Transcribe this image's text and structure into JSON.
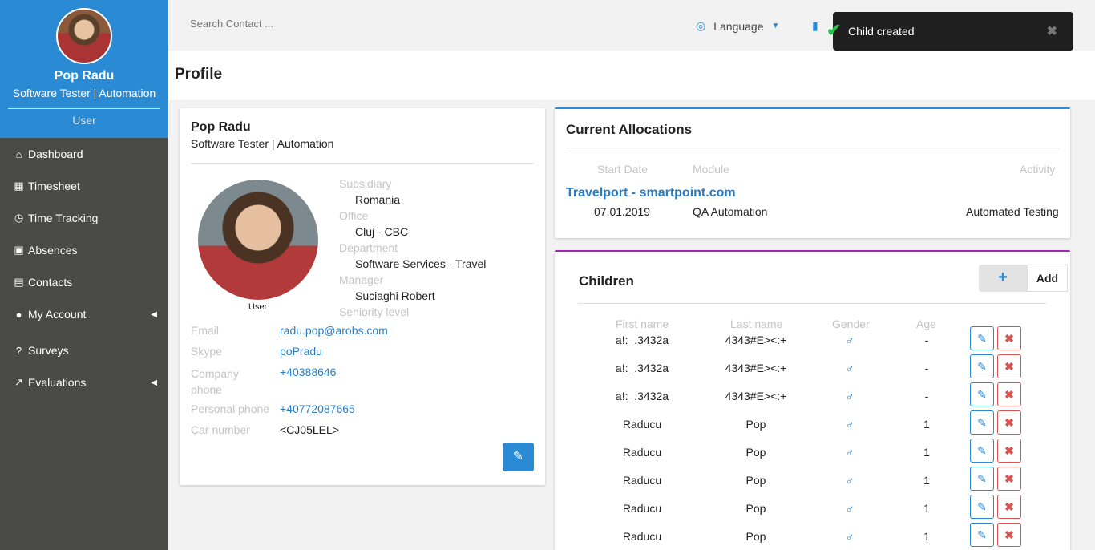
{
  "sidebar": {
    "name": "Pop Radu",
    "title": "Software Tester | Automation",
    "role": "User",
    "items": [
      {
        "label": "Dashboard",
        "icon": "home-icon"
      },
      {
        "label": "Timesheet",
        "icon": "calendar-icon"
      },
      {
        "label": "Time Tracking",
        "icon": "clock-icon"
      },
      {
        "label": "Absences",
        "icon": "calendar-remove-icon"
      },
      {
        "label": "Contacts",
        "icon": "contact-card-icon"
      },
      {
        "label": "My Account",
        "icon": "user-icon"
      },
      {
        "label": "Surveys",
        "icon": "question-icon"
      },
      {
        "label": "Evaluations",
        "icon": "line-chart-icon"
      }
    ]
  },
  "topbar": {
    "search_placeholder": "Search Contact ...",
    "language_label": "Language"
  },
  "toast": {
    "message": "Child created"
  },
  "page": {
    "title": "Profile"
  },
  "profile": {
    "name": "Pop Radu",
    "title": "Software Tester | Automation",
    "photo_caption": "User",
    "org": [
      {
        "label": "Subsidiary",
        "value": "Romania"
      },
      {
        "label": "Office",
        "value": "Cluj - CBC"
      },
      {
        "label": "Department",
        "value": "Software Services - Travel"
      },
      {
        "label": "Manager",
        "value": "Suciaghi Robert"
      },
      {
        "label": "Seniority level",
        "value": ""
      }
    ],
    "contact": [
      {
        "label": "Email",
        "value": "radu.pop@arobs.com"
      },
      {
        "label": "Skype",
        "value": "poPradu"
      },
      {
        "label": "Company phone",
        "value": "+40388646"
      },
      {
        "label": "Personal phone",
        "value": "+40772087665"
      },
      {
        "label": "Car number",
        "value": "<CJ05LEL>"
      }
    ]
  },
  "allocations": {
    "title": "Current Allocations",
    "headers": {
      "start_date": "Start Date",
      "module": "Module",
      "activity": "Activity"
    },
    "project": "Travelport - smartpoint.com",
    "row": {
      "start_date": "07.01.2019",
      "module": "QA Automation",
      "activity": "Automated Testing"
    }
  },
  "children": {
    "title": "Children",
    "add_label": "Add",
    "headers": {
      "first_name": "First name",
      "last_name": "Last name",
      "gender": "Gender",
      "age": "Age"
    },
    "rows": [
      {
        "first": "a!:_.3432a",
        "last": "4343#E><:+",
        "gender": "♂",
        "age": "-"
      },
      {
        "first": "a!:_.3432a",
        "last": "4343#E><:+",
        "gender": "♂",
        "age": "-"
      },
      {
        "first": "a!:_.3432a",
        "last": "4343#E><:+",
        "gender": "♂",
        "age": "-"
      },
      {
        "first": "Raducu",
        "last": "Pop",
        "gender": "♂",
        "age": "1"
      },
      {
        "first": "Raducu",
        "last": "Pop",
        "gender": "♂",
        "age": "1"
      },
      {
        "first": "Raducu",
        "last": "Pop",
        "gender": "♂",
        "age": "1"
      },
      {
        "first": "Raducu",
        "last": "Pop",
        "gender": "♂",
        "age": "1"
      },
      {
        "first": "Raducu",
        "last": "Pop",
        "gender": "♂",
        "age": "1"
      }
    ]
  },
  "colors": {
    "primary": "#2a8ad3",
    "sidebar": "#4a4b47",
    "danger": "#d9534f",
    "children_accent": "#9c27b0",
    "toast_bg": "#1f1f1f"
  }
}
